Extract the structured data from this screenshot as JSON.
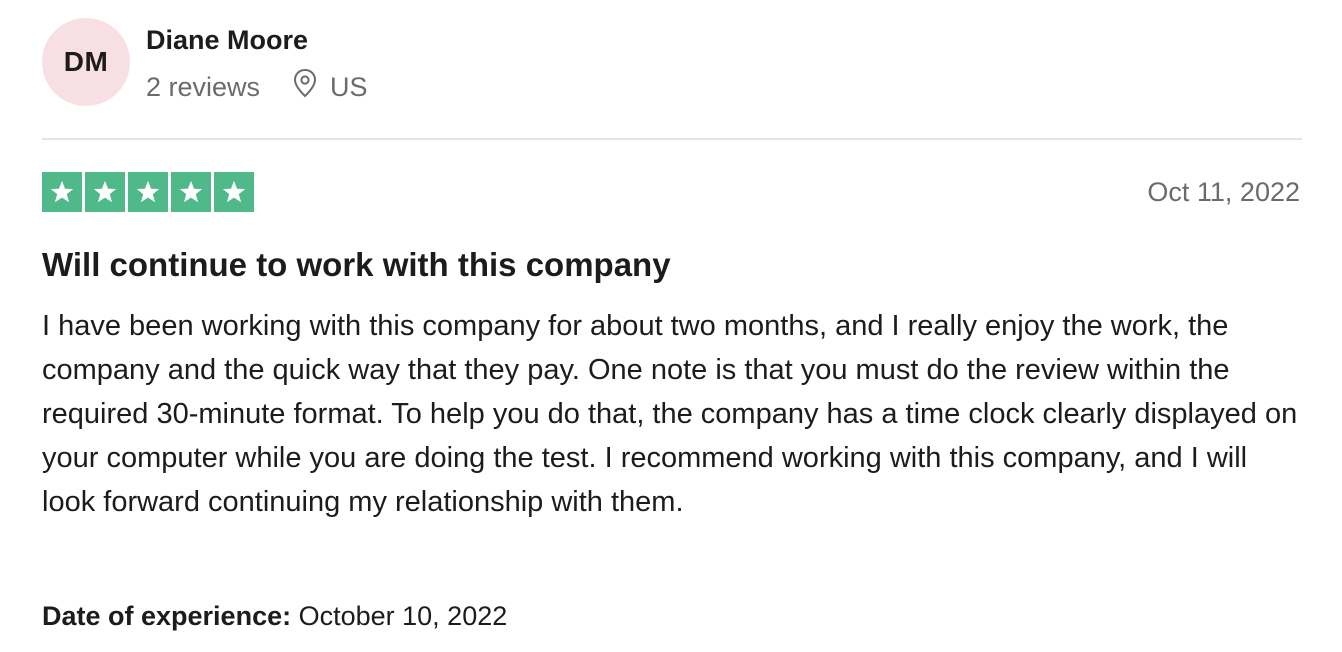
{
  "reviewer": {
    "initials": "DM",
    "name": "Diane Moore",
    "review_count": "2 reviews",
    "location": "US",
    "avatar_color": "#f8dfe4"
  },
  "review": {
    "rating": 5,
    "rating_max": 5,
    "star_color": "#4fb98a",
    "date": "Oct 11, 2022",
    "title": "Will continue to work with this company",
    "body": "I have been working with this company for about two months, and I really enjoy the work, the company and the quick way that they pay. One note is that you must do the review within the required 30-minute format. To help you do that, the company has a time clock clearly displayed on your computer while you are doing the test. I recommend working with this company, and I will look forward continuing my relationship with them.",
    "experience_label": "Date of experience:",
    "experience_date": "October 10, 2022"
  },
  "icons": {
    "location": "map-pin-icon",
    "star": "star-icon"
  }
}
